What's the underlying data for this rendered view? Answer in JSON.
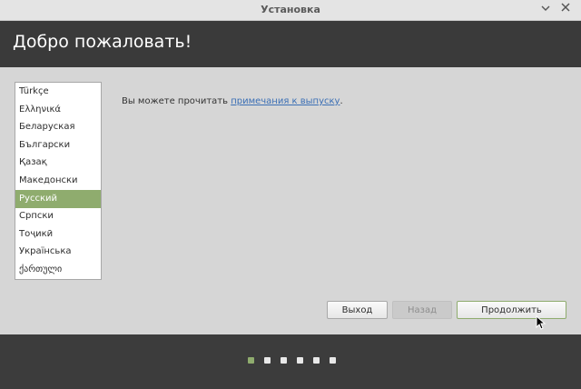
{
  "window": {
    "title": "Установка",
    "minimize_icon": "chevron-down-icon",
    "close_icon": "close-icon"
  },
  "header": {
    "title": "Добро пожаловать!"
  },
  "languages": {
    "items": [
      {
        "label": "Türkçe",
        "selected": false
      },
      {
        "label": "Ελληνικά",
        "selected": false
      },
      {
        "label": "Беларуская",
        "selected": false
      },
      {
        "label": "Български",
        "selected": false
      },
      {
        "label": "Қазақ",
        "selected": false
      },
      {
        "label": "Македонски",
        "selected": false
      },
      {
        "label": "Русский",
        "selected": true
      },
      {
        "label": "Српски",
        "selected": false
      },
      {
        "label": "Тоҷикӣ",
        "selected": false
      },
      {
        "label": "Українська",
        "selected": false
      },
      {
        "label": "ქართული",
        "selected": false
      }
    ]
  },
  "release_notes": {
    "prefix": "Вы можете прочитать ",
    "link": "примечания к выпуску",
    "suffix": "."
  },
  "buttons": {
    "quit": "Выход",
    "back": "Назад",
    "continue": "Продолжить"
  },
  "progress": {
    "total_steps": 6,
    "current_step": 1
  },
  "colors": {
    "accent": "#8fac6e",
    "link": "#3b6fb5"
  }
}
